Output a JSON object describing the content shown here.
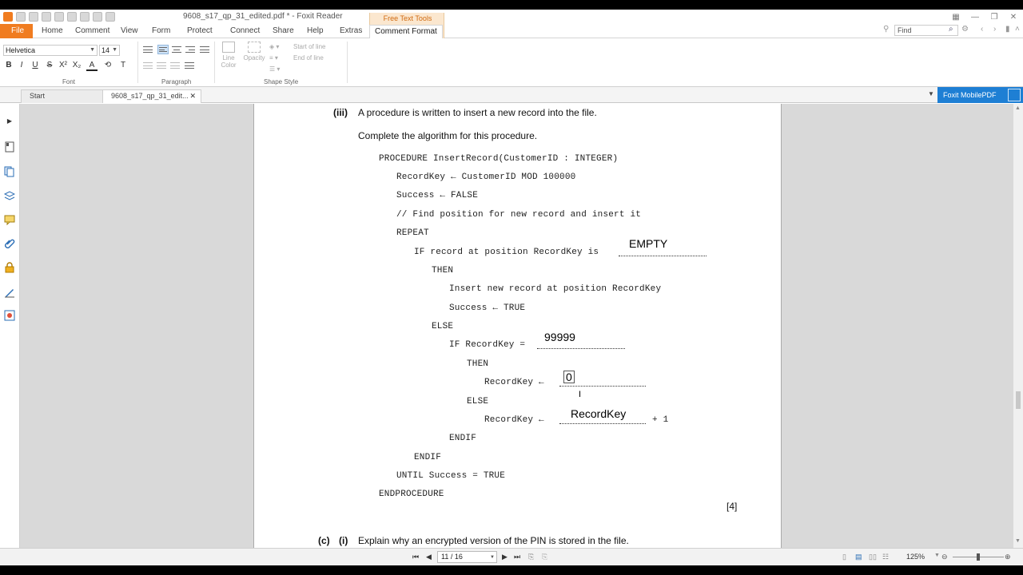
{
  "window": {
    "title": "9608_s17_qp_31_edited.pdf * - Foxit Reader",
    "contextual_group": "Free Text Tools"
  },
  "ribbon": {
    "file_tab": "File",
    "tabs": [
      "Home",
      "Comment",
      "View",
      "Form",
      "Protect",
      "Connect",
      "Share",
      "Help",
      "Extras"
    ],
    "active_tab": "Comment Format",
    "find_placeholder": "Find",
    "font_family_value": "Helvetica",
    "font_size_value": "14",
    "format_buttons": [
      "B",
      "I",
      "U",
      "S",
      "X²",
      "X₂",
      "A",
      "T"
    ],
    "groups": {
      "font": "Font",
      "paragraph": "Paragraph",
      "shape_style": "Shape Style"
    },
    "line_color": "Line Color",
    "opacity": "Opacity",
    "start_of_line": "Start of line",
    "end_of_line": "End of line"
  },
  "doc_tabs": {
    "start": "Start",
    "active": "9608_s17_qp_31_edit...",
    "mobile_pdf": "Foxit MobilePDF"
  },
  "document": {
    "part_label": "(iii)",
    "question": "A procedure is written to insert a new record into the file.",
    "instruction": "Complete the algorithm for this procedure.",
    "code_lines": [
      "PROCEDURE InsertRecord(CustomerID : INTEGER)",
      "RecordKey ← CustomerID MOD 100000",
      "Success ← FALSE",
      "// Find position for new record and insert it",
      "REPEAT",
      "IF record at position RecordKey is",
      "THEN",
      "Insert new record at position RecordKey",
      "Success ← TRUE",
      "ELSE",
      "IF RecordKey =",
      "THEN",
      "RecordKey ←",
      "ELSE",
      "RecordKey ←",
      "ENDIF",
      "ENDIF",
      "UNTIL Success = TRUE",
      "ENDPROCEDURE"
    ],
    "plus_one": "+ 1",
    "answers": {
      "empty": "EMPTY",
      "max": "99999",
      "zero": "0",
      "recordkey": "RecordKey"
    },
    "marks": "[4]",
    "next_part_letter": "(c)",
    "next_part_num": "(i)",
    "next_question": "Explain why an encrypted version of the PIN is stored in the file."
  },
  "statusbar": {
    "page_indicator": "11 / 16",
    "zoom": "125%"
  }
}
